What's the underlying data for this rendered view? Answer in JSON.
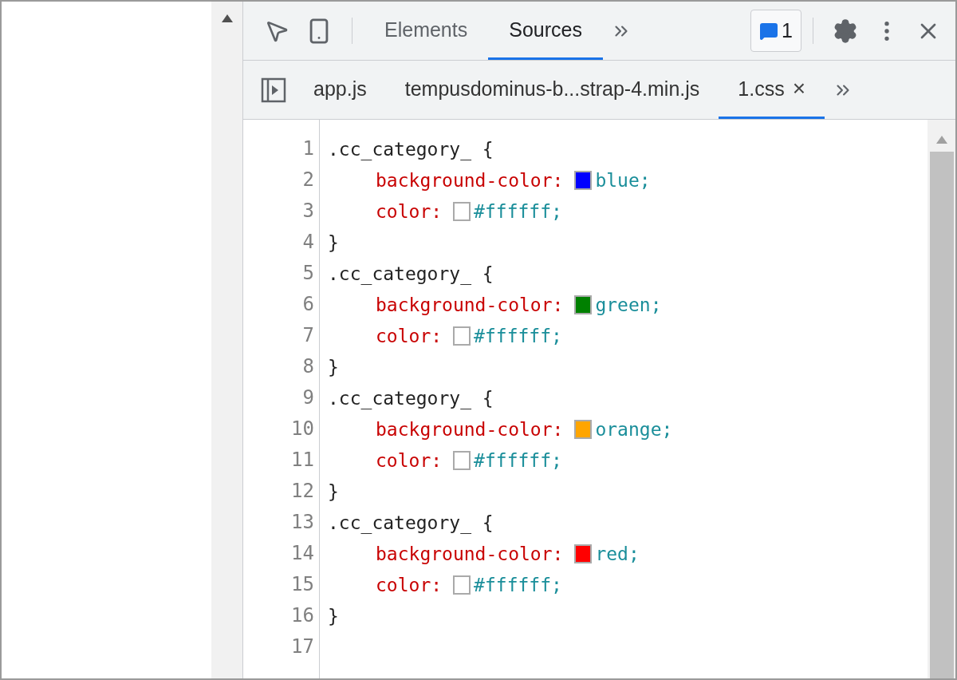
{
  "main_tabs": [
    {
      "label": "Elements",
      "selected": false
    },
    {
      "label": "Sources",
      "selected": true
    }
  ],
  "issues_badge": "1",
  "file_tabs": [
    {
      "label": "app.js",
      "selected": false,
      "closable": false
    },
    {
      "label": "tempusdominus-b...strap-4.min.js",
      "selected": false,
      "closable": false
    },
    {
      "label": "1.css",
      "selected": true,
      "closable": true
    }
  ],
  "close_glyph": "×",
  "lines": [
    {
      "number": "1",
      "kind": "selector",
      "text": ".cc_category_ {"
    },
    {
      "number": "2",
      "kind": "property",
      "property": "background-color:",
      "color": "#0000ff",
      "value": "blue;"
    },
    {
      "number": "3",
      "kind": "property",
      "property": "color:",
      "color": "#ffffff",
      "value": "#ffffff;"
    },
    {
      "number": "4",
      "kind": "close",
      "text": "}"
    },
    {
      "number": "5",
      "kind": "selector",
      "text": ".cc_category_ {"
    },
    {
      "number": "6",
      "kind": "property",
      "property": "background-color:",
      "color": "#008000",
      "value": "green;"
    },
    {
      "number": "7",
      "kind": "property",
      "property": "color:",
      "color": "#ffffff",
      "value": "#ffffff;"
    },
    {
      "number": "8",
      "kind": "close",
      "text": "}"
    },
    {
      "number": "9",
      "kind": "selector",
      "text": ".cc_category_ {"
    },
    {
      "number": "10",
      "kind": "property",
      "property": "background-color:",
      "color": "#ffa500",
      "value": "orange;"
    },
    {
      "number": "11",
      "kind": "property",
      "property": "color:",
      "color": "#ffffff",
      "value": "#ffffff;"
    },
    {
      "number": "12",
      "kind": "close",
      "text": "}"
    },
    {
      "number": "13",
      "kind": "selector",
      "text": ".cc_category_ {"
    },
    {
      "number": "14",
      "kind": "property",
      "property": "background-color:",
      "color": "#ff0000",
      "value": "red;"
    },
    {
      "number": "15",
      "kind": "property",
      "property": "color:",
      "color": "#ffffff",
      "value": "#ffffff;"
    },
    {
      "number": "16",
      "kind": "close",
      "text": "}"
    },
    {
      "number": "17",
      "kind": "blank"
    }
  ]
}
